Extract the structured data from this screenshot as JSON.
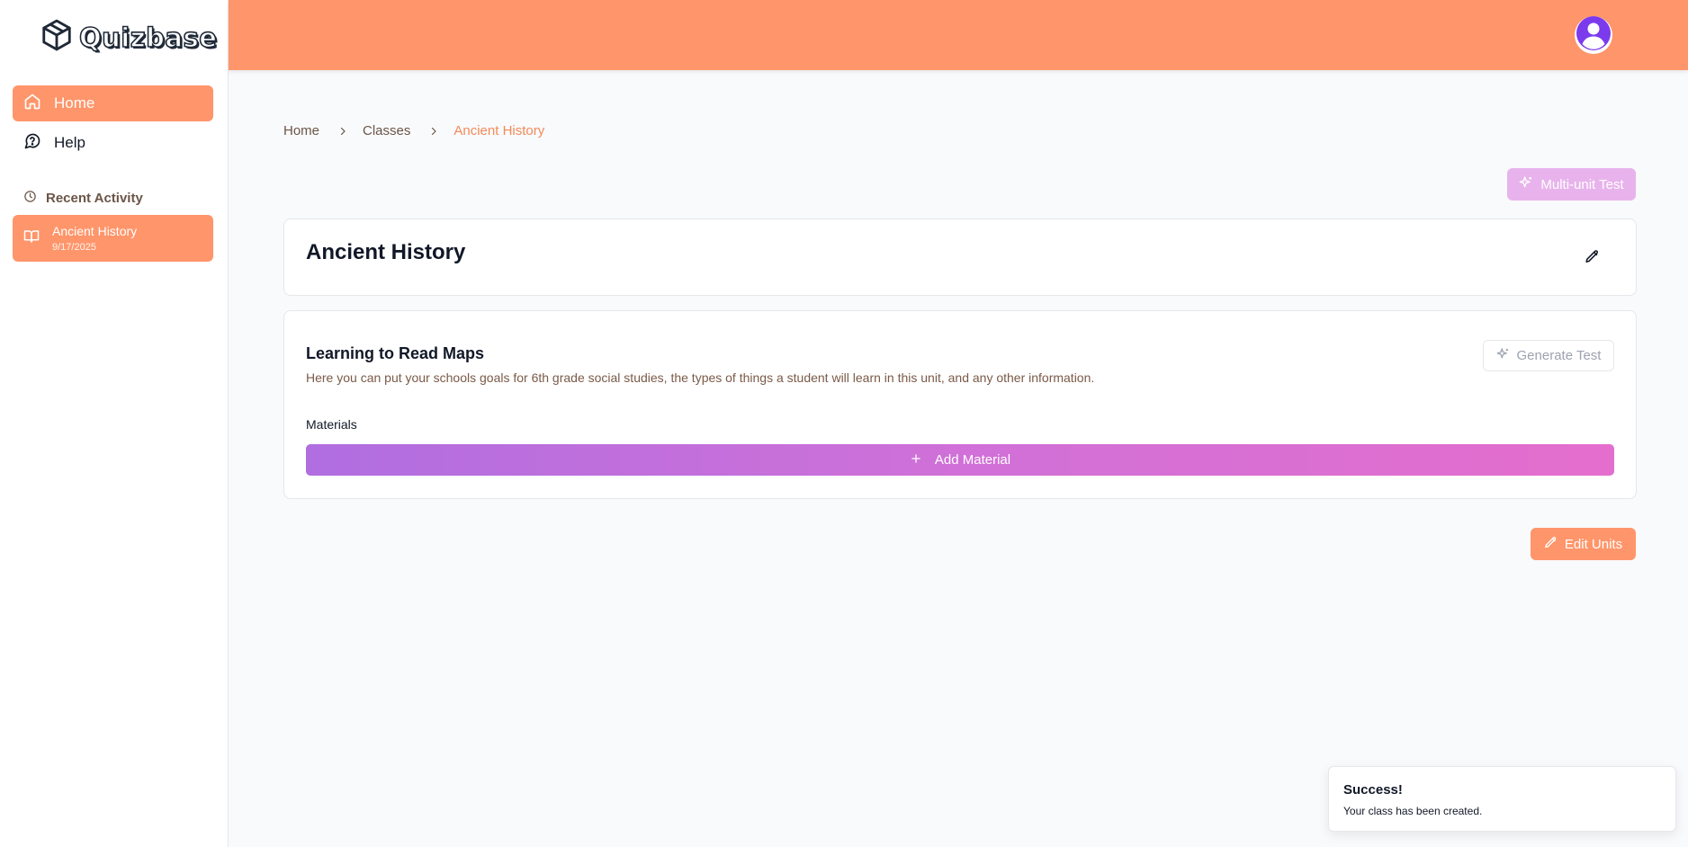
{
  "app": {
    "logo_text": "Quizbase"
  },
  "sidebar": {
    "nav": [
      {
        "label": "Home",
        "icon": "home-icon",
        "active": true
      },
      {
        "label": "Help",
        "icon": "help-icon",
        "active": false
      }
    ],
    "recent_header": "Recent Activity",
    "recent_items": [
      {
        "title": "Ancient History",
        "date": "9/17/2025",
        "icon": "book-open-icon"
      }
    ]
  },
  "breadcrumb": {
    "items": [
      "Home",
      "Classes",
      "Ancient History"
    ]
  },
  "toolbar": {
    "multi_unit_test_label": "Multi-unit Test"
  },
  "class_card": {
    "title": "Ancient History"
  },
  "unit_card": {
    "title": "Learning to Read Maps",
    "description": "Here you can put your schools goals for 6th grade social studies, the types of things a student will learn in this unit, and any other information.",
    "generate_test_label": "Generate Test",
    "materials_label": "Materials",
    "add_material_label": "Add Material"
  },
  "edit_units_label": "Edit Units",
  "toast": {
    "title": "Success!",
    "message": "Your class has been created."
  },
  "colors": {
    "brand_orange": "#ff956a",
    "accent_text": "#f28a5a",
    "purple_gradient_start": "#b06ee0",
    "purple_gradient_end": "#e46ecd",
    "avatar_purple": "#7c3aed"
  }
}
